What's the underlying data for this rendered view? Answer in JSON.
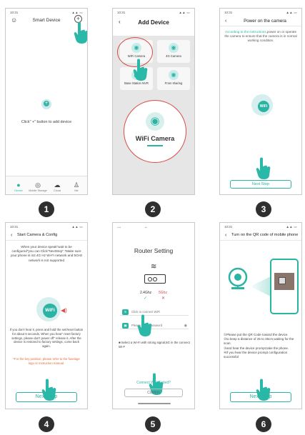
{
  "accent_color": "#2bb3a3",
  "alert_color": "#d84a4a",
  "steps": [
    "1",
    "2",
    "3",
    "4",
    "5",
    "6"
  ],
  "p1": {
    "status_time": "10:31",
    "title": "Smart Device",
    "hint": "Click\" +\" button to add device",
    "tabs": [
      "Device",
      "Mobile Storage",
      "Cloud",
      "Me"
    ]
  },
  "p2": {
    "status_time": "10:31",
    "title": "Add Device",
    "options": [
      "WiFi Camera",
      "4G Camera",
      "Base Station NVR",
      "From sharing"
    ],
    "zoom_label": "WiFi Camera"
  },
  "p3": {
    "status_time": "10:31",
    "title": "Power on the camera",
    "desc_hl": "According to the instructions,",
    "desc": "power on or operate the camera to ensure that the camera is in normal working condition.",
    "button": "Next Step"
  },
  "p4": {
    "status_time": "10:31",
    "title": "Start Camera & Config",
    "desc": "When your device speak\"wait to be configured\"you can Click\"NextStep\" *Make sure your phone is in2.4G Hz Wi-Fi network and 5GHz network is not supported",
    "desc2": "If you don't hear it, press and hold the set/reset button for about 5 seconds. When you hear\" reset factory settings, please don't power off\" release it. After the device is restored to factory settings, come back again.",
    "desc3": "*For the key position, please refer to the fuselage logo or instruction manual.",
    "icon_label": "WiFi",
    "button": "Next Step"
  },
  "p5": {
    "title": "Router Setting",
    "freq_left": "2.4Ghz",
    "freq_right": "5Ghz",
    "field1": "Click to connect WiFi",
    "field2": "Please input password",
    "note": "■ Select a Wi-Fi with strong signal,5G in the connect Wi-F",
    "failed": "Connect WiFi Failed?",
    "confirm": "Confirm"
  },
  "p6": {
    "status_time": "10:31",
    "title": "Turn on the QR code of mobile phone",
    "lines": [
      "①Please put the QR Code toward the device.",
      "②to keep a distance of 25 to 35cm,waiting for the scan.",
      "③and hear the device prompt,take the phone.",
      "④if you hear the device prompt configuration successful"
    ],
    "button": "Next Step"
  }
}
